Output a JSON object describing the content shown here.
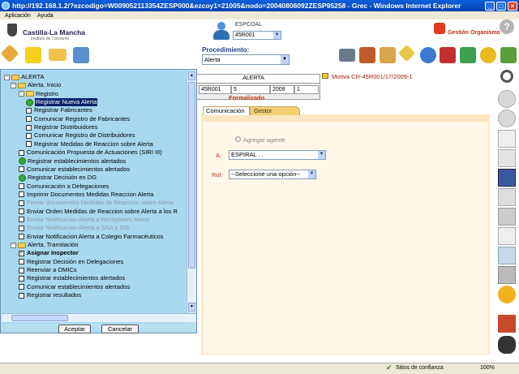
{
  "window": {
    "title": "http://192.168.1.2/?ezcodigo=W009052113354ZESP000&ezcoy1=21005&nodo=20040806092ZESP95258 - Grec - Windows Internet Explorer"
  },
  "menubar": [
    "Aplicación",
    "Ayuda"
  ],
  "header": {
    "logo_title": "Castilla-La Mancha",
    "logo_sub": "Instituto de Consumo",
    "espcoal_label": "ESPCOAL",
    "espcoal_value": "45R001",
    "gestion_label": "Gestión Organismo"
  },
  "toolbar": {
    "procedimiento_label": "Procedimiento:",
    "procedimiento_value": "Alerta"
  },
  "alerta": {
    "title": "ALERTA",
    "code": "45R001",
    "num": "5",
    "year": "2009",
    "seq": "1",
    "status": "Formalizado"
  },
  "motiva": "Motiva CR-45R001/17/2009-1",
  "tabs": {
    "comunicacion": "Comunicación",
    "gestor": "Gestor"
  },
  "form": {
    "agregar_label": "Agregar agente",
    "a_label": "A:",
    "a_value": "ESPIRAL . .",
    "rol_label": "Rol:",
    "rol_value": "--Seleccione una opción--"
  },
  "tree": {
    "items": [
      {
        "label": "ALERTA",
        "level": 0,
        "type": "root"
      },
      {
        "label": "Alerta. Inicio",
        "level": 1,
        "type": "folder"
      },
      {
        "label": "Registro",
        "level": 2,
        "type": "folder"
      },
      {
        "label": "Registrar Nueva Alerta",
        "level": 3,
        "type": "done",
        "state": "selected"
      },
      {
        "label": "Registrar Fabricantes",
        "level": 3,
        "type": "check"
      },
      {
        "label": "Comunicar Registro de Fabricantes",
        "level": 3,
        "type": "check"
      },
      {
        "label": "Registrar Distribuidores",
        "level": 3,
        "type": "check"
      },
      {
        "label": "Comunicar Registro de Distribuidores",
        "level": 3,
        "type": "check"
      },
      {
        "label": "Registrar Medidas de Reaccion sobre Alerta",
        "level": 3,
        "type": "check"
      },
      {
        "label": "Comunicación Propuesta de Actuaciones (SIRI III)",
        "level": 2,
        "type": "check"
      },
      {
        "label": "Registrar establecimientos alertados",
        "level": 2,
        "type": "done"
      },
      {
        "label": "Comunicar establecimientos alertados",
        "level": 2,
        "type": "check"
      },
      {
        "label": "Registrar Decisión en DG",
        "level": 2,
        "type": "done"
      },
      {
        "label": "Comunicación a Delegaciones",
        "level": 2,
        "type": "check"
      },
      {
        "label": "Imprimir Documentos Medidas Reaccion Alerta",
        "level": 2,
        "type": "check"
      },
      {
        "label": "Firmar documentos Medidas de Reaccion sobre Alerta",
        "level": 2,
        "type": "check",
        "state": "disabled"
      },
      {
        "label": "Enviar Orden Medidas de Reaccion sobre Alerta a los R",
        "level": 2,
        "type": "check"
      },
      {
        "label": "Enviar Notificacion Alerta a Receptores Alerta",
        "level": 2,
        "type": "check",
        "state": "disabled"
      },
      {
        "label": "Enviar Notificacion Alerta a SSA y SIS",
        "level": 2,
        "type": "check",
        "state": "disabled"
      },
      {
        "label": "Enviar Notificacion Alerta a Colegio Farmacéuticos",
        "level": 2,
        "type": "check"
      },
      {
        "label": "Alerta. Tramitación",
        "level": 1,
        "type": "folder"
      },
      {
        "label": "Asignar Inspector",
        "level": 2,
        "type": "checked",
        "state": "bold"
      },
      {
        "label": "Registrar Decisión en Delegaciones",
        "level": 2,
        "type": "check"
      },
      {
        "label": "Reenviar a OMICs",
        "level": 2,
        "type": "check"
      },
      {
        "label": "Registrar establecimientos alertados",
        "level": 2,
        "type": "check"
      },
      {
        "label": "Comunicar establecimientos alertados",
        "level": 2,
        "type": "check"
      },
      {
        "label": "Registrar resultados",
        "level": 2,
        "type": "check"
      }
    ],
    "accept": "Aceptar",
    "cancel": "Cancelar"
  },
  "status": {
    "trust": "Sitios de confianza",
    "zoom": "100%"
  },
  "colors": {
    "title_bar": "#0842b0",
    "tree_bg": "#a8d8f0",
    "panel_bg": "#fde7c2",
    "accent_red": "#c03015"
  }
}
